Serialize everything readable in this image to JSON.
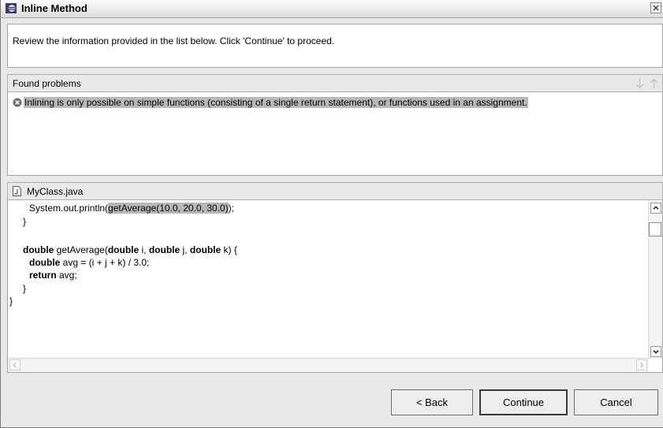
{
  "window": {
    "title": "Inline Method",
    "description": "Review the information provided in the list below. Click 'Continue' to proceed."
  },
  "problems": {
    "header": "Found problems",
    "items": [
      "Inlining is only possible on simple functions (consisting of a single return statement), or functions used in an assignment."
    ]
  },
  "source": {
    "filename": "MyClass.java",
    "lines": {
      "l1_pre": "System.out.println(",
      "l1_hl": "getAverage(10.0, 20.0, 30.0)",
      "l1_post": ");",
      "l2": "}",
      "l3_kw": "double",
      "l3_a": " getAverage(",
      "l3_kw2": "double",
      "l3_b": " i, ",
      "l3_kw3": "double",
      "l3_c": " j, ",
      "l3_kw4": "double",
      "l3_d": " k) {",
      "l4_kw": "double",
      "l4_rest": " avg = (i + j + k) / 3.0;",
      "l5_kw": "return",
      "l5_rest": " avg;",
      "l6": "}",
      "l7": "}"
    }
  },
  "buttons": {
    "back": "< Back",
    "continue": "Continue",
    "cancel": "Cancel"
  }
}
